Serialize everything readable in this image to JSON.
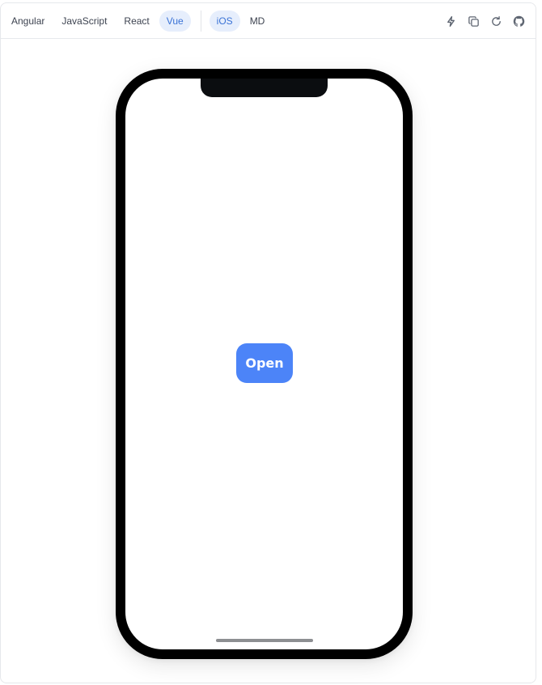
{
  "toolbar": {
    "frameworks": [
      {
        "label": "Angular",
        "active": false
      },
      {
        "label": "JavaScript",
        "active": false
      },
      {
        "label": "React",
        "active": false
      },
      {
        "label": "Vue",
        "active": true
      }
    ],
    "modes": [
      {
        "label": "iOS",
        "active": true
      },
      {
        "label": "MD",
        "active": false
      }
    ],
    "actions": [
      {
        "icon": "lightning-icon"
      },
      {
        "icon": "copy-icon"
      },
      {
        "icon": "refresh-icon"
      },
      {
        "icon": "github-icon"
      }
    ]
  },
  "preview": {
    "open_button_label": "Open"
  },
  "colors": {
    "active_tab_bg": "#e6eefc",
    "active_tab_text": "#3b73d6",
    "primary_button": "#4c84f8",
    "phone_bezel": "#000000",
    "icon": "#5f6672"
  }
}
